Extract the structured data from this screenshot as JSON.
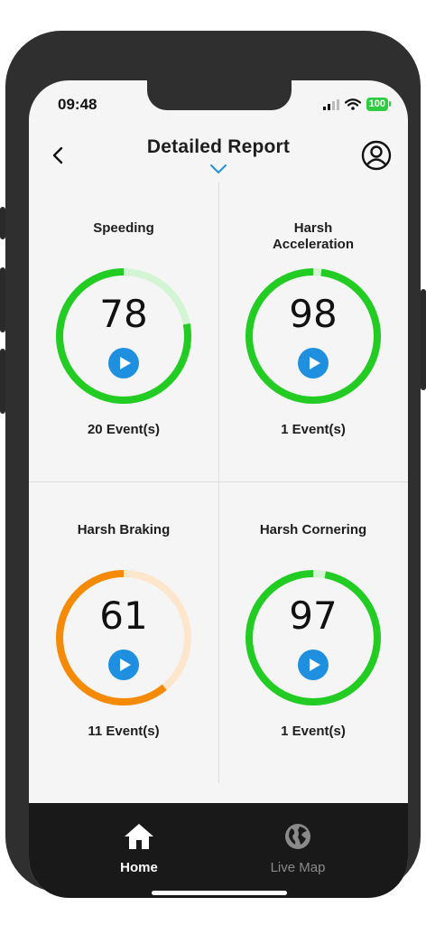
{
  "status": {
    "time": "09:48",
    "battery": "100"
  },
  "header": {
    "title": "Detailed Report"
  },
  "colors": {
    "green": "#22cc22",
    "green_track": "#d3f5d3",
    "orange": "#f58a07",
    "orange_track": "#fde6cc",
    "play": "#1f8fe0"
  },
  "cards": [
    {
      "title": "Speeding",
      "score": "78",
      "events": "20 Event(s)",
      "level": 0.78,
      "color": "green"
    },
    {
      "title": "Harsh\nAcceleration",
      "score": "98",
      "events": "1 Event(s)",
      "level": 0.98,
      "color": "green"
    },
    {
      "title": "Harsh Braking",
      "score": "61",
      "events": "11 Event(s)",
      "level": 0.61,
      "color": "orange"
    },
    {
      "title": "Harsh Cornering",
      "score": "97",
      "events": "1 Event(s)",
      "level": 0.97,
      "color": "green"
    }
  ],
  "tabs": [
    {
      "label": "Home",
      "icon": "home-icon",
      "active": true
    },
    {
      "label": "Live Map",
      "icon": "globe-icon",
      "active": false
    }
  ]
}
